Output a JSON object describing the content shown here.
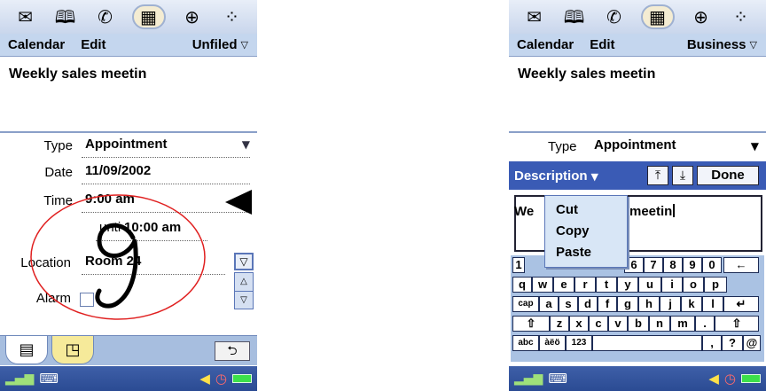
{
  "screens": [
    {
      "app_icons": [
        "mail-icon",
        "contacts-book-icon",
        "phone-icon",
        "calendar-icon",
        "web-icon",
        "apps-grid-icon"
      ],
      "app_icon_glyphs": [
        "✉",
        "🕮",
        "✆",
        "▦",
        "⊕",
        "⁘"
      ],
      "menu": {
        "items": [
          "Calendar",
          "Edit"
        ],
        "category": "Unfiled"
      },
      "title": "Weekly sales meetin",
      "fields": {
        "type_label": "Type",
        "type_value": "Appointment",
        "date_label": "Date",
        "date_value": "11/09/2002",
        "time_label": "Time",
        "time_value": "9:00 am",
        "until_label": "unti",
        "until_value": "10:00 am",
        "location_label": "Location",
        "location_value": "Room 24",
        "alarm_label": "Alarm"
      },
      "tabs": [
        "details-tab",
        "note-tab"
      ],
      "back_glyph": "⮌"
    },
    {
      "app_icons": [
        "mail-icon",
        "contacts-book-icon",
        "phone-icon",
        "calendar-icon",
        "web-icon",
        "apps-grid-icon"
      ],
      "app_icon_glyphs": [
        "✉",
        "🕮",
        "✆",
        "▦",
        "⊕",
        "⁘"
      ],
      "menu": {
        "items": [
          "Calendar",
          "Edit"
        ],
        "category": "Business"
      },
      "title": "Weekly sales meetin",
      "type_label": "Type",
      "type_value": "Appointment",
      "description_label": "Description",
      "done_label": "Done",
      "edit_text_left": "We",
      "edit_text_right": "meetin",
      "context_menu": [
        "Cut",
        "Copy",
        "Paste"
      ],
      "keyboard": {
        "row1": [
          "1",
          "6",
          "7",
          "8",
          "9",
          "0",
          "←"
        ],
        "row2": [
          "q",
          "w",
          "e",
          "r",
          "t",
          "y",
          "u",
          "i",
          "o",
          "p"
        ],
        "row3": [
          "cap",
          "a",
          "s",
          "d",
          "f",
          "g",
          "h",
          "j",
          "k",
          "l",
          "↵"
        ],
        "row4": [
          "⇧",
          "z",
          "x",
          "c",
          "v",
          "b",
          "n",
          "m",
          ".",
          "⇧"
        ],
        "row5": [
          "abc",
          "àëö",
          "123",
          ",",
          "?",
          "@"
        ]
      }
    }
  ],
  "colors": {
    "accent": "#3a5bb5",
    "menu_bg": "#c4d6ee",
    "annotation_circle": "#e02020"
  }
}
